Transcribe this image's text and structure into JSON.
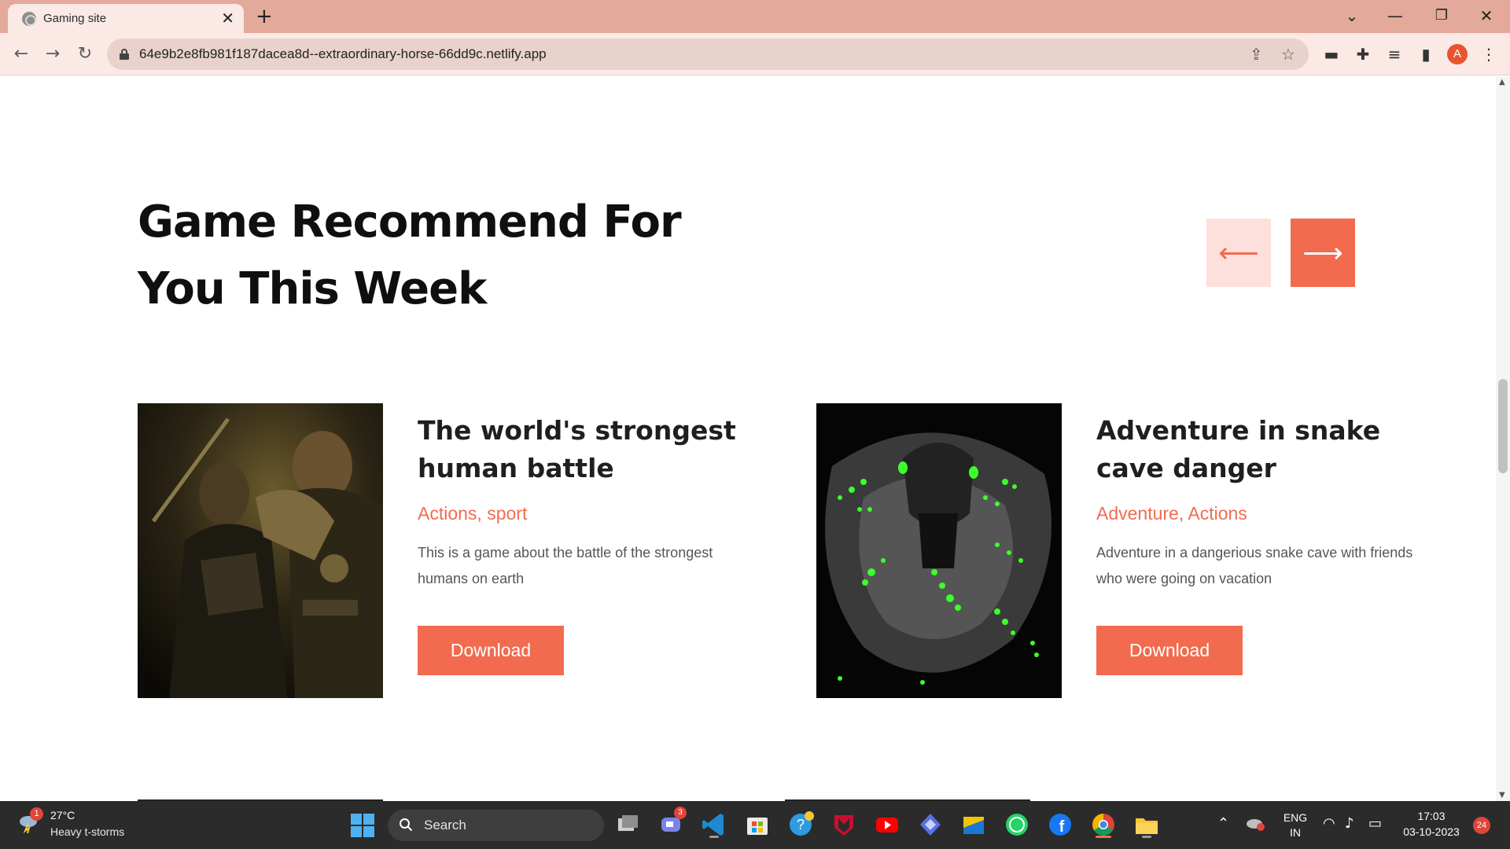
{
  "browser": {
    "tab_title": "Gaming site",
    "tab_close": "✕",
    "new_tab": "+",
    "url": "64e9b2e8fb981f187dacea8d--extraordinary-horse-66dd9c.netlify.app",
    "profile_initial": "A",
    "controls": {
      "minimize": "—",
      "maximize": "❐",
      "close": "✕",
      "tab_search": "⌄"
    }
  },
  "page": {
    "heading_line1": "Game Recommend For",
    "heading_line2": "You This Week",
    "prev_arrow": "⟵",
    "next_arrow": "⟶",
    "colors": {
      "accent": "#f26b4f",
      "accent_light": "#fde0db",
      "heading": "#0f0f0f"
    },
    "cards": [
      {
        "title": "The world's strongest human battle",
        "genre": "Actions, sport",
        "description": "This is a game about the battle of the strongest humans on earth",
        "button": "Download",
        "image": "action-fighters-image"
      },
      {
        "title": "Adventure in snake cave danger",
        "genre": "Adventure, Actions",
        "description": "Adventure in a dangerious snake cave with friends who were going on vacation",
        "button": "Download",
        "image": "green-snake-image"
      }
    ]
  },
  "taskbar": {
    "weather_temp": "27°C",
    "weather_desc": "Heavy t-storms",
    "weather_badge": "1",
    "search_label": "Search",
    "teams_badge": "3",
    "language_line1": "ENG",
    "language_line2": "IN",
    "time": "17:03",
    "date": "03-10-2023",
    "notification_count": "24",
    "pinned_apps": [
      "task-view",
      "teams-chat",
      "vscode",
      "microsoft-store",
      "help",
      "mcafee",
      "youtube",
      "copilot",
      "file-manager",
      "whatsapp",
      "facebook",
      "chrome",
      "file-explorer"
    ]
  }
}
